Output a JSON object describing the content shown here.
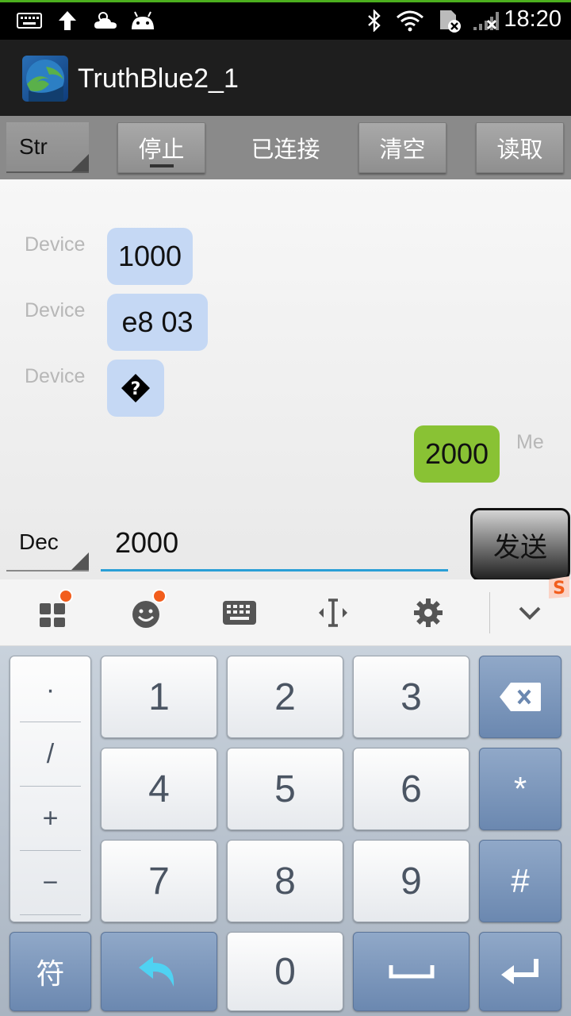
{
  "status_bar": {
    "time": "18:20",
    "icons": [
      "keyboard-icon",
      "upload-arrow-icon",
      "weather-icon",
      "android-icon",
      "bluetooth-icon",
      "wifi-icon",
      "sim-icon",
      "signal-icon"
    ]
  },
  "action_bar": {
    "title": "TruthBlue2_1"
  },
  "toolbar": {
    "mode_spinner": "Str",
    "stop_label": "停止",
    "status_label": "已连接",
    "clear_label": "清空",
    "read_label": "读取"
  },
  "messages": [
    {
      "sender": "Device",
      "text": "1000",
      "side": "left"
    },
    {
      "sender": "Device",
      "text": "e8 03",
      "side": "left"
    },
    {
      "sender": "Device",
      "text": "◆",
      "side": "left"
    },
    {
      "sender": "Me",
      "text": "2000",
      "side": "right"
    }
  ],
  "input": {
    "format_spinner": "Dec",
    "value": "2000",
    "send_label": "发送"
  },
  "keyboard_toolbar": {
    "tools": [
      "apps-grid-icon",
      "emoji-icon",
      "keyboard-icon",
      "cursor-icon",
      "settings-icon",
      "collapse-chevron-icon"
    ]
  },
  "keyboard": {
    "symbols": [
      "·",
      "/",
      "+",
      "−"
    ],
    "digits": [
      "1",
      "2",
      "3",
      "4",
      "5",
      "6",
      "7",
      "8",
      "9",
      "0"
    ],
    "star": "*",
    "hash": "#",
    "fu_label": "符"
  },
  "colors": {
    "device_bubble": "#c5d8f4",
    "me_bubble": "#89c234",
    "input_underline": "#2a9fd6",
    "badge": "#f25d1c"
  }
}
